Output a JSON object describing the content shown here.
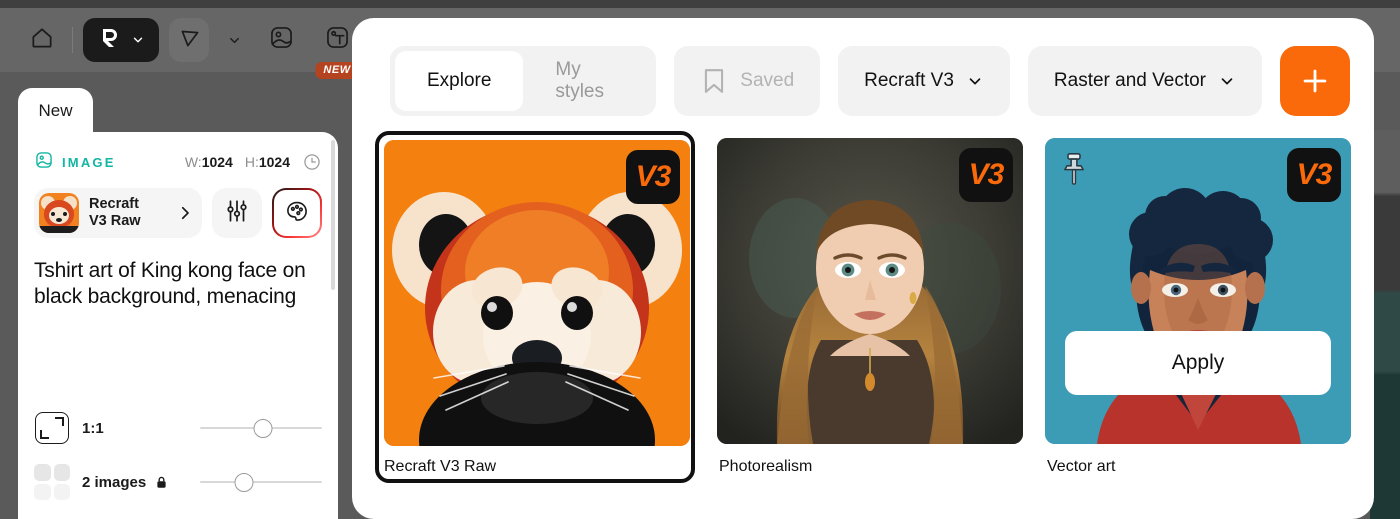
{
  "toolbar": {
    "home_icon": "home-icon",
    "logo_icon": "recraft-logo-icon",
    "logo_chevron": "chevron-down-icon",
    "select_tool_icon": "cursor-select-icon",
    "select_chevron": "chevron-down-icon",
    "image_tool_icon": "image-icon",
    "text_tool_icon": "text-tool-icon",
    "mockup_tool_icon": "tshirt-mockup-icon",
    "new_badge": "NEW"
  },
  "left_panel": {
    "tab_label": "New",
    "section_icon": "image-icon",
    "section_label": "IMAGE",
    "width_key": "W:",
    "width_value": "1024",
    "height_key": "H:",
    "height_value": "1024",
    "history_icon": "clock-history-icon",
    "style_chip": {
      "thumbnail": "red-panda-thumbnail",
      "name_line1": "Recraft",
      "name_line2": "V3 Raw",
      "arrow_icon": "chevron-right-icon"
    },
    "settings_icon": "sliders-icon",
    "palette_icon": "palette-icon",
    "prompt_text": "Tshirt art of King kong face on black background, menacing",
    "controls": [
      {
        "icon": "aspect-ratio-icon",
        "label": "1:1",
        "locked": false,
        "slider_percent": 52
      },
      {
        "icon": "image-count-grid-icon",
        "label": "2 images",
        "locked": true,
        "lock_icon": "lock-icon",
        "slider_percent": 36
      }
    ]
  },
  "modal": {
    "tabs": [
      {
        "label": "Explore",
        "active": true
      },
      {
        "label": "My styles",
        "active": false
      }
    ],
    "saved_button": {
      "label": "Saved",
      "icon": "bookmark-icon"
    },
    "model_dropdown": {
      "label": "Recraft V3",
      "icon": "chevron-down-icon"
    },
    "type_dropdown": {
      "label": "Raster and Vector",
      "icon": "chevron-down-icon"
    },
    "add_button": {
      "icon": "plus-icon"
    },
    "cards": [
      {
        "label": "Recraft V3 Raw",
        "badge": "V3",
        "selected": true,
        "pinned": false,
        "hovered": false,
        "artwork": "red-panda-portrait"
      },
      {
        "label": "Photorealism",
        "badge": "V3",
        "selected": false,
        "pinned": false,
        "hovered": false,
        "artwork": "woman-portrait-photo"
      },
      {
        "label": "Vector art",
        "badge": "V3",
        "selected": false,
        "pinned": true,
        "hovered": true,
        "apply_label": "Apply",
        "artwork": "vector-man-portrait"
      }
    ]
  },
  "colors": {
    "accent_orange": "#fa6a0a",
    "teal_label": "#13b5a3",
    "badge_red": "#b4441f",
    "backdrop": "#5a5a5a"
  }
}
